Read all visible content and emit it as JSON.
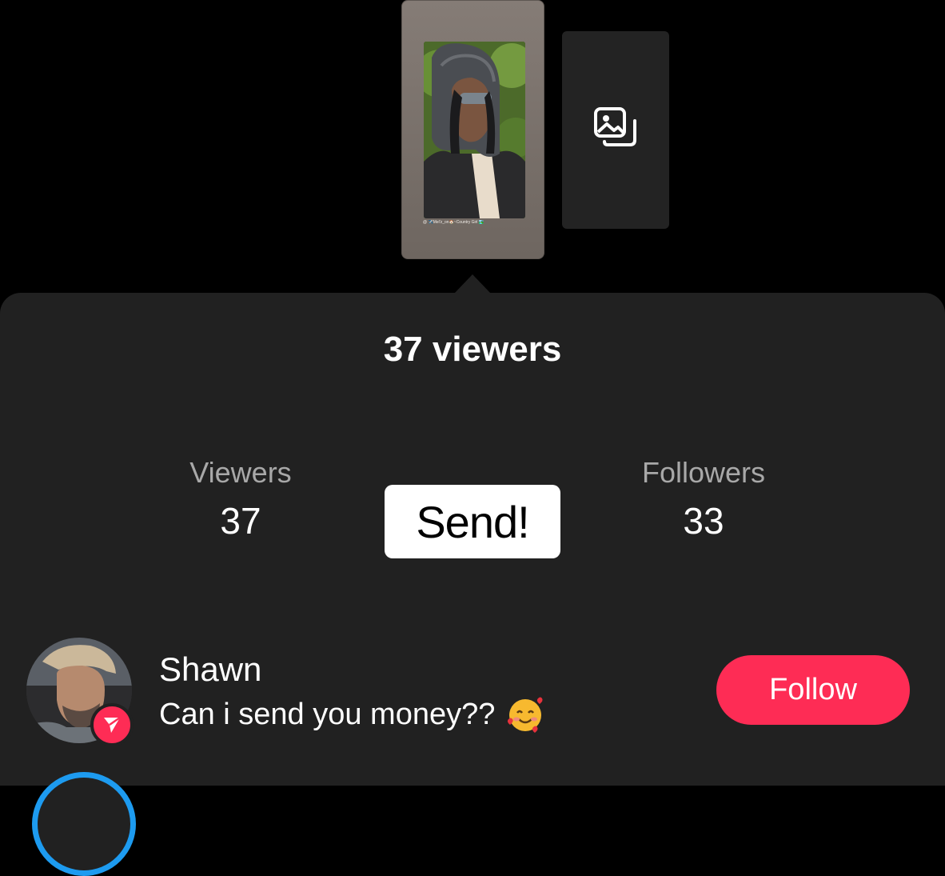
{
  "story": {
    "caption": "@ ✈️Mel'z_on🏠~Country Girl 🏞️"
  },
  "icons": {
    "gallery": "photo-gallery-icon",
    "share_badge": "share-arrow-icon",
    "emoji": "smiling-face-with-hearts"
  },
  "sheet": {
    "title": "37 viewers"
  },
  "stats": {
    "viewers": {
      "label": "Viewers",
      "value": "37"
    },
    "followers": {
      "label": "Followers",
      "value": "33"
    }
  },
  "sticker": {
    "text": "Send!"
  },
  "viewer_list": [
    {
      "name": "Shawn",
      "message": "Can i send you money??",
      "emoji": "🥰",
      "action_label": "Follow"
    }
  ],
  "colors": {
    "accent": "#fe2c55",
    "sheet_bg": "#212121",
    "ring": "#1d9bf0"
  }
}
